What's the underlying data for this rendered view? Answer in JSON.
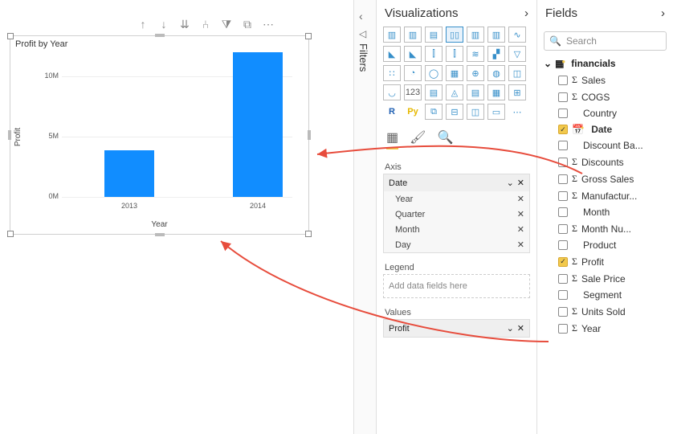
{
  "chart_data": {
    "type": "bar",
    "title": "Profit by Year",
    "xlabel": "Year",
    "ylabel": "Profit",
    "categories": [
      "2013",
      "2014"
    ],
    "values": [
      3900000,
      12000000
    ],
    "ylim": [
      0,
      12000000
    ],
    "yticks": [
      {
        "v": 0,
        "label": "0M"
      },
      {
        "v": 5000000,
        "label": "5M"
      },
      {
        "v": 10000000,
        "label": "10M"
      }
    ]
  },
  "filters": {
    "label": "Filters"
  },
  "viz": {
    "title": "Visualizations",
    "wells": {
      "axis": {
        "label": "Axis",
        "header": "Date",
        "levels": [
          "Year",
          "Quarter",
          "Month",
          "Day"
        ]
      },
      "legend": {
        "label": "Legend",
        "placeholder": "Add data fields here"
      },
      "values": {
        "label": "Values",
        "items": [
          "Profit"
        ]
      }
    }
  },
  "fields": {
    "title": "Fields",
    "search_placeholder": "Search",
    "table": "financials",
    "columns": [
      {
        "name": "Sales",
        "sigma": true,
        "checked": false
      },
      {
        "name": "COGS",
        "sigma": true,
        "checked": false
      },
      {
        "name": "Country",
        "sigma": false,
        "checked": false
      },
      {
        "name": "Date",
        "sigma": false,
        "checked": true,
        "calendar": true,
        "bold": true
      },
      {
        "name": "Discount Ba...",
        "sigma": false,
        "checked": false
      },
      {
        "name": "Discounts",
        "sigma": true,
        "checked": false
      },
      {
        "name": "Gross Sales",
        "sigma": true,
        "checked": false
      },
      {
        "name": "Manufactur...",
        "sigma": true,
        "checked": false
      },
      {
        "name": "Month",
        "sigma": false,
        "checked": false
      },
      {
        "name": "Month Nu...",
        "sigma": true,
        "checked": false
      },
      {
        "name": "Product",
        "sigma": false,
        "checked": false
      },
      {
        "name": "Profit",
        "sigma": true,
        "checked": true
      },
      {
        "name": "Sale Price",
        "sigma": true,
        "checked": false
      },
      {
        "name": "Segment",
        "sigma": false,
        "checked": false
      },
      {
        "name": "Units Sold",
        "sigma": true,
        "checked": false
      },
      {
        "name": "Year",
        "sigma": true,
        "checked": false
      }
    ]
  }
}
